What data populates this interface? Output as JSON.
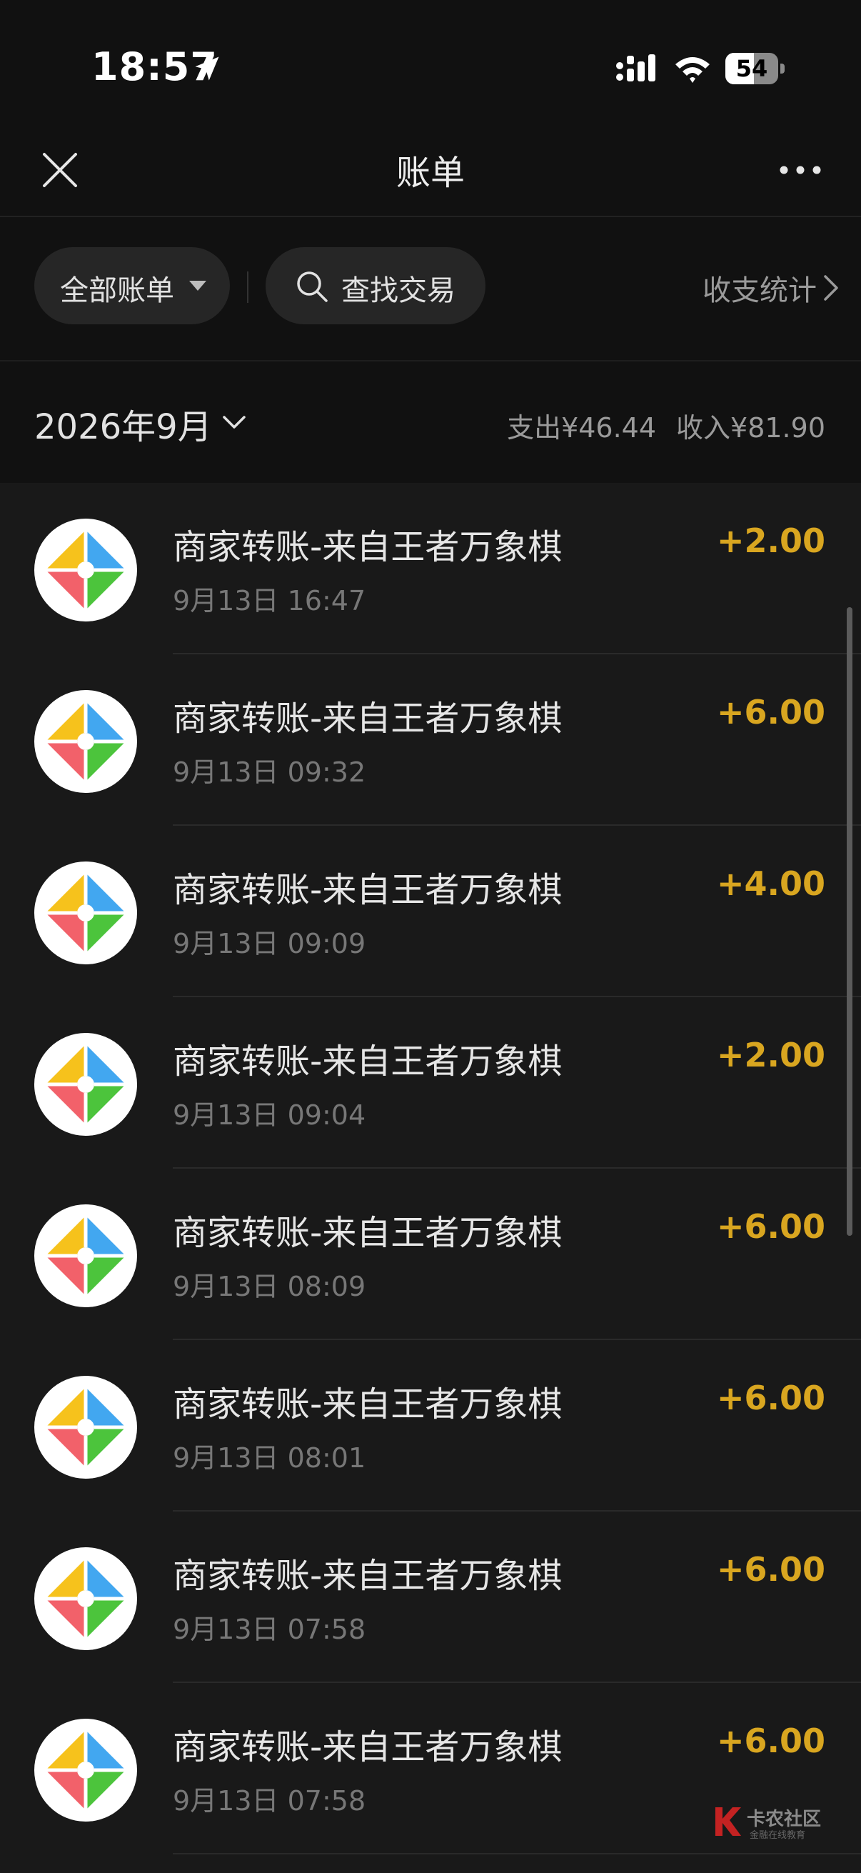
{
  "status_bar": {
    "time": "18:57",
    "battery": "54",
    "battery_level": 0.54
  },
  "header": {
    "title": "账单"
  },
  "filters": {
    "all_bills_label": "全部账单",
    "search_label": "查找交易",
    "stats_label": "收支统计"
  },
  "month": {
    "label": "2026年9月",
    "expense": "支出¥46.44",
    "income": "收入¥81.90"
  },
  "transactions": [
    {
      "title": "商家转账-来自王者万象棋",
      "time": "9月13日 16:47",
      "amount": "+2.00"
    },
    {
      "title": "商家转账-来自王者万象棋",
      "time": "9月13日 09:32",
      "amount": "+6.00"
    },
    {
      "title": "商家转账-来自王者万象棋",
      "time": "9月13日 09:09",
      "amount": "+4.00"
    },
    {
      "title": "商家转账-来自王者万象棋",
      "time": "9月13日 09:04",
      "amount": "+2.00"
    },
    {
      "title": "商家转账-来自王者万象棋",
      "time": "9月13日 08:09",
      "amount": "+6.00"
    },
    {
      "title": "商家转账-来自王者万象棋",
      "time": "9月13日 08:01",
      "amount": "+6.00"
    },
    {
      "title": "商家转账-来自王者万象棋",
      "time": "9月13日 07:58",
      "amount": "+6.00"
    },
    {
      "title": "商家转账-来自王者万象棋",
      "time": "9月13日 07:58",
      "amount": "+6.00"
    }
  ],
  "watermark": {
    "name": "卡农社区",
    "tagline": "金融在线教育"
  },
  "colors": {
    "income_amount": "#d9a620",
    "background": "#191919",
    "header_background": "#111111"
  }
}
